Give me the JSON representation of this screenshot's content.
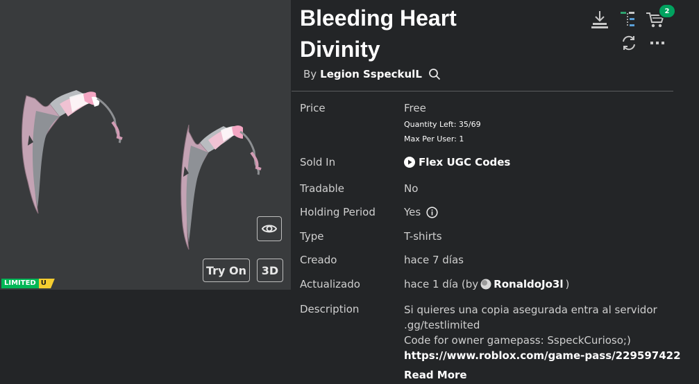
{
  "item": {
    "title_line1": "Bleeding Heart",
    "title_line2": "Divinity",
    "by_prefix": "By",
    "creator": "Legion SspeckulL"
  },
  "header_icons": {
    "download": "download-icon",
    "hierarchy": "hierarchy-icon",
    "cart": "cart-icon",
    "cart_count": "2",
    "refresh": "refresh-icon",
    "more": "more-icon"
  },
  "preview": {
    "try_on": "Try On",
    "three_d": "3D",
    "limited": "LIMITED",
    "unique": "U"
  },
  "details": {
    "price_label": "Price",
    "price_value": "Free",
    "quantity_left": "Quantity Left: 35/69",
    "max_per_user": "Max Per User: 1",
    "sold_in_label": "Sold In",
    "sold_in_value": "Flex UGC Codes",
    "tradable_label": "Tradable",
    "tradable_value": "No",
    "holding_label": "Holding Period",
    "holding_value": "Yes",
    "type_label": "Type",
    "type_value": "T-shirts",
    "created_label": "Creado",
    "created_value": "hace 7 días",
    "updated_label": "Actualizado",
    "updated_value": "hace 1 día (by",
    "updated_user": "RonaldoJo3l",
    "updated_close": ")",
    "description_label": "Description",
    "description_lines": [
      "Si quieres una copia asegurada entra al servidor",
      ".gg/testlimited",
      "Code for owner gamepass: SspeckCurioso;)",
      "https://www.roblox.com/game-pass/229597422"
    ],
    "read_more": "Read More"
  },
  "colors": {
    "background": "#232527",
    "preview_bg": "#393b3d",
    "limited_green": "#02b757",
    "unique_yellow": "#f5cd30",
    "badge_green": "#01a25f"
  }
}
